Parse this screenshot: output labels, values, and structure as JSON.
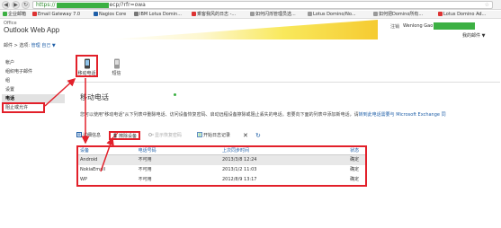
{
  "browser": {
    "back": "◀",
    "forward": "▶",
    "reload": "↻",
    "url_scheme": "https://",
    "url_path": "ecp/?rfr=owa",
    "star": "☆"
  },
  "bookmarks": [
    {
      "label": "企业邮箱",
      "color": "#3cb043"
    },
    {
      "label": "Email Gateway 7.0",
      "color": "#d33"
    },
    {
      "label": "Nagios Core",
      "color": "#1f5fa8"
    },
    {
      "label": "IBM Lotus Domin...",
      "color": "#777"
    },
    {
      "label": "乘客我风的日志 -...",
      "color": "#d33"
    },
    {
      "label": "如何闪烁管理员选...",
      "color": "#999"
    },
    {
      "label": "Lotus Domino/No...",
      "color": "#999"
    },
    {
      "label": "如何把Domino所有...",
      "color": "#999"
    },
    {
      "label": "Lotus Domino Ad...",
      "color": "#d33"
    }
  ],
  "header": {
    "brand_top": "Office",
    "brand": "Outlook Web App",
    "signout": "注销",
    "user_prefix": "Wenlong Gao",
    "my_mail": "我的邮件 ▼"
  },
  "breadcrumb": {
    "prefix": "邮件 > 选项:",
    "link": "管理 自己",
    "caret": "▼"
  },
  "sidebar": {
    "items": [
      {
        "label": "帐户"
      },
      {
        "label": "组织电子邮件"
      },
      {
        "label": "组"
      },
      {
        "label": "设置"
      },
      {
        "label": "电话"
      },
      {
        "label": "阻止或允许"
      }
    ]
  },
  "tiles": {
    "mobile": "移动电话",
    "sms": "短信"
  },
  "content": {
    "title": "移动电话",
    "desc_text": "您可以使用\"移动电话\"从下列表中删除电话、访问设备恢复密码、启动远程设备擦除或阻止丢失的电话。若要向下面的列表中添加新电话，请",
    "desc_link": "转到此电话需要与 Microsoft Exchange 同"
  },
  "toolbar": {
    "details": "详细信息",
    "wipe": "擦除设备",
    "recovery": "显示恢复密码",
    "log": "开始日志记录",
    "delete": "✕",
    "refresh": "↻"
  },
  "table": {
    "headers": [
      "设备",
      "电话号码",
      "上次同步时间",
      "状态"
    ],
    "rows": [
      [
        "Android",
        "不可用",
        "2013/3/8 12:24",
        "确定"
      ],
      [
        "NokiaEmail",
        "不可用",
        "2013/1/2 11:03",
        "确定"
      ],
      [
        "WP",
        "不可用",
        "2012/8/9 13:17",
        "确定"
      ]
    ]
  },
  "colors": {
    "annotation_red": "#e2202a",
    "link_blue": "#1f5fa8",
    "mask_green": "#3cb043"
  }
}
